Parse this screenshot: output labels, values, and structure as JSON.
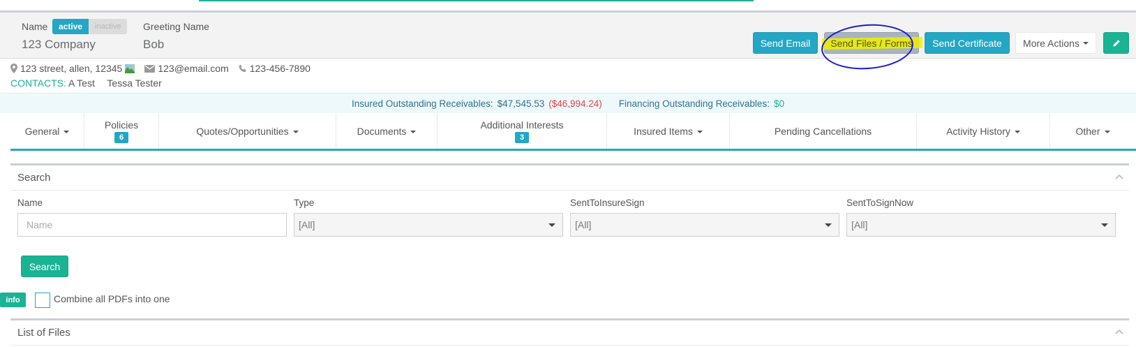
{
  "account": {
    "name_label": "Name",
    "status_active": "active",
    "status_inactive": "inactive",
    "company_name": "123 Company",
    "greeting_label": "Greeting Name",
    "greeting_value": "Bob"
  },
  "actions": {
    "send_email": "Send Email",
    "send_files": "Send Files / Forms",
    "send_certificate": "Send Certificate",
    "more_actions": "More Actions",
    "edit_icon": "pencil-icon"
  },
  "contact": {
    "address": "123 street, allen, 12345",
    "email": "123@email.com",
    "phone": "123-456-7890",
    "contacts_label": "CONTACTS:",
    "contacts": [
      "A Test",
      "Tessa Tester"
    ]
  },
  "receivables": {
    "insured_label": "Insured Outstanding Receivables:",
    "insured_amount": "$47,545.53",
    "insured_negative": "($46,994.24)",
    "financing_label": "Financing Outstanding Receivables:",
    "financing_amount": "$0"
  },
  "tabs": [
    {
      "label": "General",
      "dropdown": true
    },
    {
      "label": "Policies",
      "badge": "6"
    },
    {
      "label": "Quotes/Opportunities",
      "dropdown": true
    },
    {
      "label": "Documents",
      "dropdown": true
    },
    {
      "label": "Additional Interests",
      "badge": "3"
    },
    {
      "label": "Insured Items",
      "dropdown": true
    },
    {
      "label": "Pending Cancellations"
    },
    {
      "label": "Activity History",
      "dropdown": true
    },
    {
      "label": "Other",
      "dropdown": true
    }
  ],
  "search": {
    "title": "Search",
    "name_label": "Name",
    "name_placeholder": "Name",
    "type_label": "Type",
    "type_value": "[All]",
    "insuresign_label": "SentToInsureSign",
    "insuresign_value": "[All]",
    "signnow_label": "SentToSignNow",
    "signnow_value": "[All]",
    "button": "Search"
  },
  "pdf": {
    "info_badge": "info",
    "combine_label": "Combine all PDFs into one",
    "checked": false
  },
  "files": {
    "title": "List of Files"
  },
  "colors": {
    "info": "#23a7c4",
    "primary": "#1ab394",
    "danger": "#e0454a",
    "highlight": "#f0f000",
    "annotation": "#1a1ad0"
  }
}
